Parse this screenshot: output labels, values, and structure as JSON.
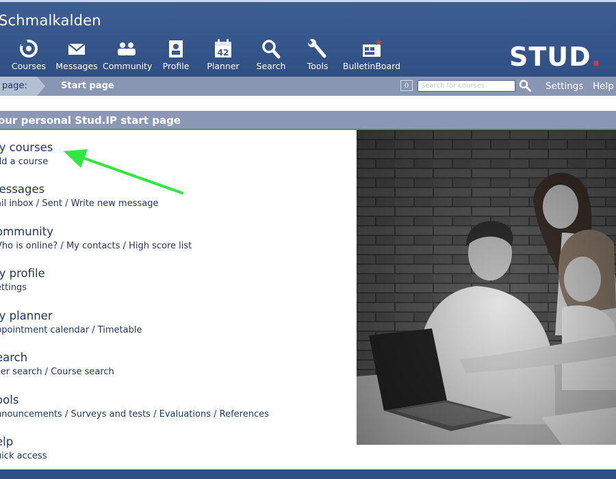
{
  "header": {
    "site_title": "Schmalkalden",
    "nav": [
      {
        "label": "Courses",
        "icon": "courses-icon"
      },
      {
        "label": "Messages",
        "icon": "envelope-icon"
      },
      {
        "label": "Community",
        "icon": "people-icon"
      },
      {
        "label": "Profile",
        "icon": "profile-card-icon"
      },
      {
        "label": "Planner",
        "icon": "calendar-icon",
        "calendar_day": "42"
      },
      {
        "label": "Search",
        "icon": "magnifier-icon"
      },
      {
        "label": "Tools",
        "icon": "wrench-icon"
      },
      {
        "label": "BulletinBoard",
        "icon": "bulletin-board-icon"
      }
    ],
    "logo_text": "STUD",
    "logo_dot": "."
  },
  "breadcrumb": {
    "prefix": "page:",
    "current": "Start page"
  },
  "toolbar": {
    "counter": "0",
    "search_placeholder": "Search for courses",
    "settings_label": "Settings",
    "help_label": "Help"
  },
  "section_title": "our personal Stud.IP start page",
  "menu": [
    {
      "title": "ly courses",
      "links": [
        "dd a course"
      ]
    },
    {
      "title": "lessages",
      "links": [
        "ail inbox",
        "Sent",
        "Write new message"
      ]
    },
    {
      "title": "ommunity",
      "links": [
        "Vho is online?",
        "My contacts",
        "High score list"
      ]
    },
    {
      "title": "ly profile",
      "links": [
        "ettings"
      ]
    },
    {
      "title": "ly planner",
      "links": [
        "ppointment calendar",
        "Timetable"
      ]
    },
    {
      "title": "earch",
      "links": [
        "ser search",
        "Course search"
      ]
    },
    {
      "title": "ools",
      "links": [
        "nnouncements",
        "Surveys and tests",
        "Evaluations",
        "References"
      ]
    },
    {
      "title": "elp",
      "links": [
        "uick access"
      ]
    }
  ],
  "colors": {
    "header_bg": "#2f4f85",
    "breadcrumb_bg": "#8896b4",
    "link_color": "#1f3567",
    "annotation_arrow": "#2ee83d",
    "logo_dot": "#e5352d"
  }
}
